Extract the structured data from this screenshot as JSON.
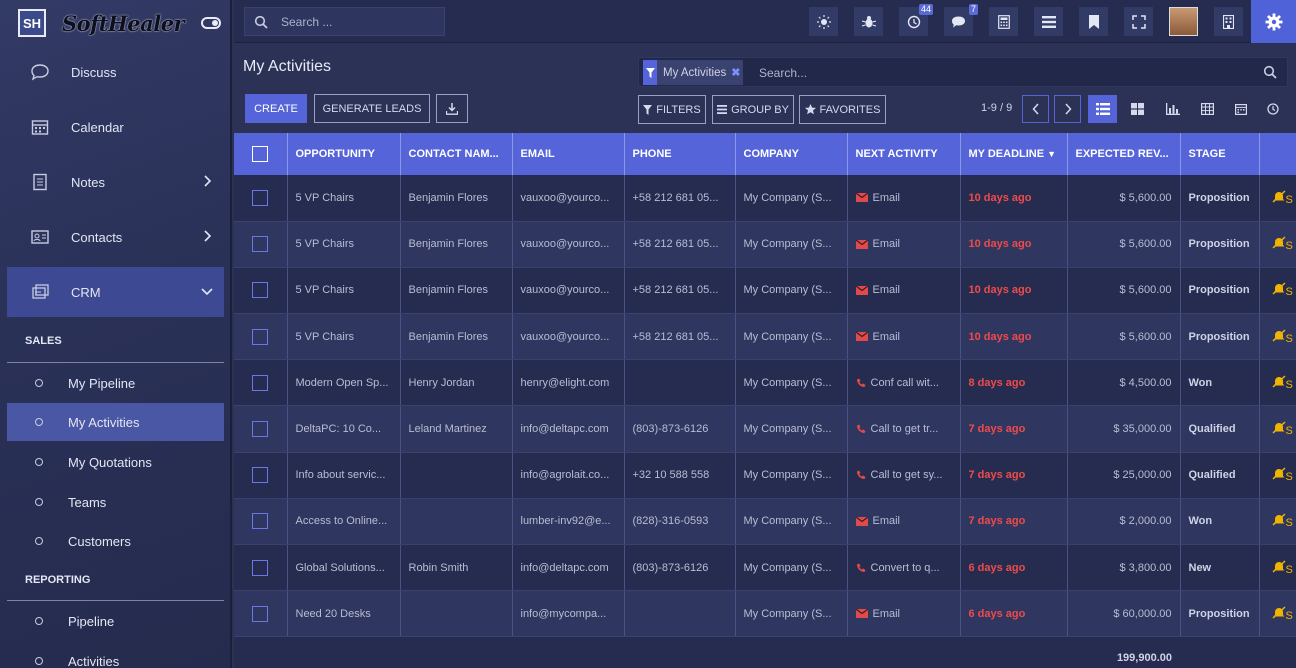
{
  "brand": {
    "logo_text": "SH",
    "name": "SoftHealer"
  },
  "nav": {
    "items": [
      {
        "label": "Discuss",
        "icon": "chat-icon"
      },
      {
        "label": "Calendar",
        "icon": "calendar-icon"
      },
      {
        "label": "Notes",
        "icon": "notes-icon"
      },
      {
        "label": "Contacts",
        "icon": "contacts-icon"
      },
      {
        "label": "CRM",
        "icon": "crm-icon"
      }
    ],
    "sections": [
      {
        "title": "SALES"
      },
      {
        "title": "REPORTING"
      }
    ],
    "sales_items": [
      "My Pipeline",
      "My Activities",
      "My Quotations",
      "Teams",
      "Customers"
    ],
    "reporting_items": [
      "Pipeline",
      "Activities"
    ]
  },
  "topbar": {
    "search_placeholder": "Search ...",
    "activity_count": "44",
    "message_count": "7"
  },
  "page": {
    "title": "My Activities"
  },
  "search": {
    "facet_label": "My Activities",
    "placeholder": "Search..."
  },
  "buttons": {
    "create": "CREATE",
    "generate": "GENERATE LEADS",
    "filters": "FILTERS",
    "group_by": "GROUP BY",
    "favorites": "FAVORITES"
  },
  "pager": {
    "range": "1-9 / 9"
  },
  "table": {
    "columns": [
      "OPPORTUNITY",
      "CONTACT NAM...",
      "EMAIL",
      "PHONE",
      "COMPANY",
      "NEXT ACTIVITY",
      "MY DEADLINE",
      "EXPECTED REV...",
      "STAGE"
    ],
    "rows": [
      {
        "opp": "5 VP Chairs",
        "contact": "Benjamin Flores",
        "email": "vauxoo@yourco...",
        "phone": "+58 212 681 05...",
        "company": "My Company (S...",
        "act_type": "email",
        "activity": "Email",
        "deadline": "10 days ago",
        "revenue": "$ 5,600.00",
        "stage": "Proposition"
      },
      {
        "opp": "5 VP Chairs",
        "contact": "Benjamin Flores",
        "email": "vauxoo@yourco...",
        "phone": "+58 212 681 05...",
        "company": "My Company (S...",
        "act_type": "email",
        "activity": "Email",
        "deadline": "10 days ago",
        "revenue": "$ 5,600.00",
        "stage": "Proposition"
      },
      {
        "opp": "5 VP Chairs",
        "contact": "Benjamin Flores",
        "email": "vauxoo@yourco...",
        "phone": "+58 212 681 05...",
        "company": "My Company (S...",
        "act_type": "email",
        "activity": "Email",
        "deadline": "10 days ago",
        "revenue": "$ 5,600.00",
        "stage": "Proposition"
      },
      {
        "opp": "5 VP Chairs",
        "contact": "Benjamin Flores",
        "email": "vauxoo@yourco...",
        "phone": "+58 212 681 05...",
        "company": "My Company (S...",
        "act_type": "email",
        "activity": "Email",
        "deadline": "10 days ago",
        "revenue": "$ 5,600.00",
        "stage": "Proposition"
      },
      {
        "opp": "Modern Open Sp...",
        "contact": "Henry Jordan",
        "email": "henry@elight.com",
        "phone": "",
        "company": "My Company (S...",
        "act_type": "call",
        "activity": "Conf call wit...",
        "deadline": "8 days ago",
        "revenue": "$ 4,500.00",
        "stage": "Won"
      },
      {
        "opp": "DeltaPC: 10 Co...",
        "contact": "Leland Martinez",
        "email": "info@deltapc.com",
        "phone": "(803)-873-6126",
        "company": "My Company (S...",
        "act_type": "call",
        "activity": "Call to get tr...",
        "deadline": "7 days ago",
        "revenue": "$ 35,000.00",
        "stage": "Qualified"
      },
      {
        "opp": "Info about servic...",
        "contact": "",
        "email": "info@agrolait.co...",
        "phone": "+32 10 588 558",
        "company": "My Company (S...",
        "act_type": "call",
        "activity": "Call to get sy...",
        "deadline": "7 days ago",
        "revenue": "$ 25,000.00",
        "stage": "Qualified"
      },
      {
        "opp": "Access to Online...",
        "contact": "",
        "email": "lumber-inv92@e...",
        "phone": "(828)-316-0593",
        "company": "My Company (S...",
        "act_type": "email",
        "activity": "Email",
        "deadline": "7 days ago",
        "revenue": "$ 2,000.00",
        "stage": "Won"
      },
      {
        "opp": "Global Solutions...",
        "contact": "Robin Smith",
        "email": "info@deltapc.com",
        "phone": "(803)-873-6126",
        "company": "My Company (S...",
        "act_type": "call",
        "activity": "Convert to q...",
        "deadline": "6 days ago",
        "revenue": "$ 3,800.00",
        "stage": "New"
      },
      {
        "opp": "Need 20 Desks",
        "contact": "",
        "email": "info@mycompa...",
        "phone": "",
        "company": "My Company (S...",
        "act_type": "email",
        "activity": "Email",
        "deadline": "6 days ago",
        "revenue": "$ 60,000.00",
        "stage": "Proposition"
      }
    ],
    "extra_col_glyph": "S",
    "total": "199,900.00"
  },
  "colors": {
    "accent": "#5565d9",
    "sidebar": "#2a3157",
    "deadline": "#ef4b4b",
    "warn": "#f0b400"
  }
}
